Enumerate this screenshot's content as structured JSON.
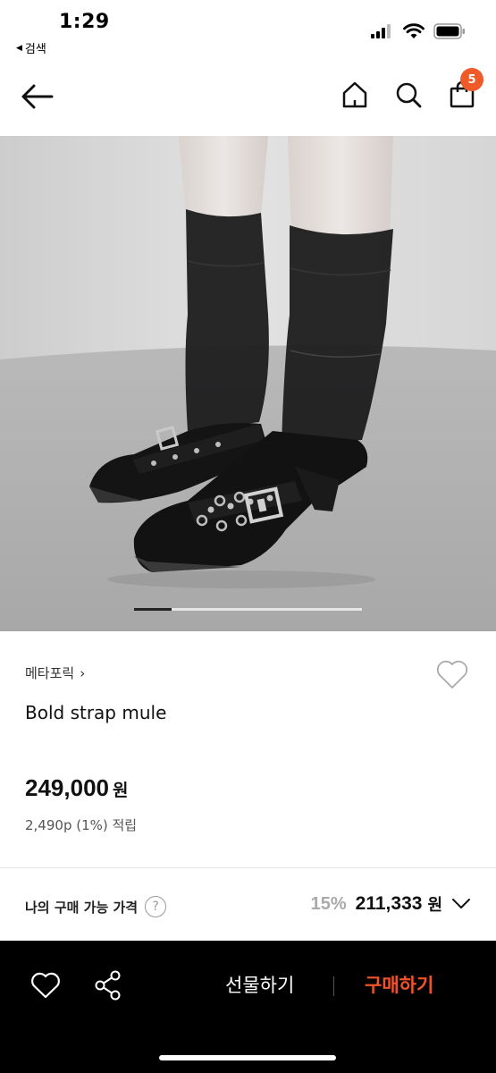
{
  "status_bar": {
    "time": "1:29",
    "back_app_label": "검색",
    "icons": [
      "signal-icon",
      "wifi-icon",
      "battery-icon"
    ]
  },
  "nav": {
    "back_icon": "arrow-left-icon",
    "home_icon": "home-icon",
    "search_icon": "search-icon",
    "cart_icon": "shopping-bag-icon",
    "cart_count": "5"
  },
  "product": {
    "image_icon": "product-photo",
    "carousel_position": 1,
    "brand": "메타포릭",
    "brand_chevron": "›",
    "name": "Bold strap mule",
    "price": "249,000",
    "price_unit": "원",
    "points": "2,490p (1%) 적립"
  },
  "my_price": {
    "label": "나의 구매 가능 가격",
    "help_symbol": "?",
    "discount": "15%",
    "price": "211,333",
    "price_unit": "원"
  },
  "bottom_bar": {
    "gift_label": "선물하기",
    "buy_label": "구매하기"
  },
  "colors": {
    "accent": "#f05a28",
    "buy_text": "#f0532c",
    "bottom_bar_bg": "#000000"
  }
}
